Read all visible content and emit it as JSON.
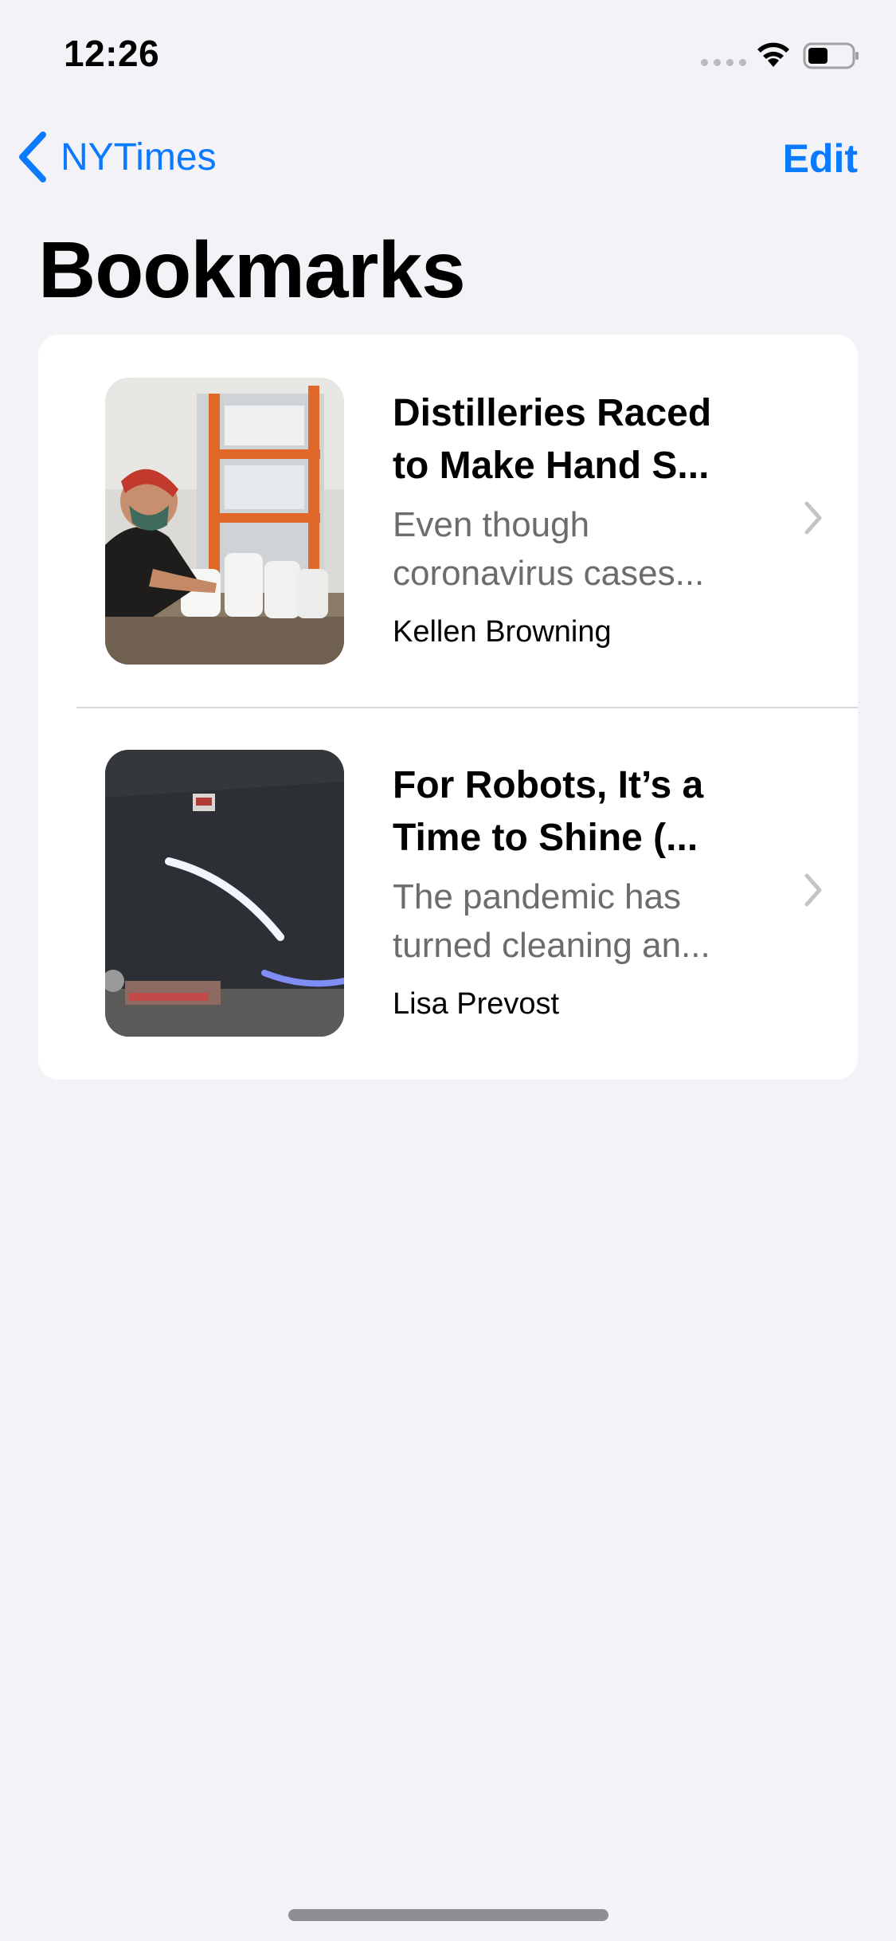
{
  "status_bar": {
    "time": "12:26"
  },
  "nav": {
    "back_label": "NYTimes",
    "edit_label": "Edit"
  },
  "page": {
    "title": "Bookmarks"
  },
  "bookmarks": [
    {
      "title_line1": "Distilleries Raced",
      "title_line2": "to Make Hand S...",
      "summary_line1": "Even though",
      "summary_line2": "coronavirus cases...",
      "author": "Kellen Browning",
      "image": "worker-filling-sanitizer-jugs"
    },
    {
      "title_line1": "For Robots, It’s a",
      "title_line2": "Time to Shine (...",
      "summary_line1": "The pandemic has",
      "summary_line2": "turned cleaning an...",
      "author": "Lisa Prevost",
      "image": "floor-cleaning-robot"
    }
  ],
  "colors": {
    "accent": "#0a7aff",
    "background": "#f2f2f7",
    "card": "#ffffff",
    "secondary_text": "#6b6b70"
  }
}
